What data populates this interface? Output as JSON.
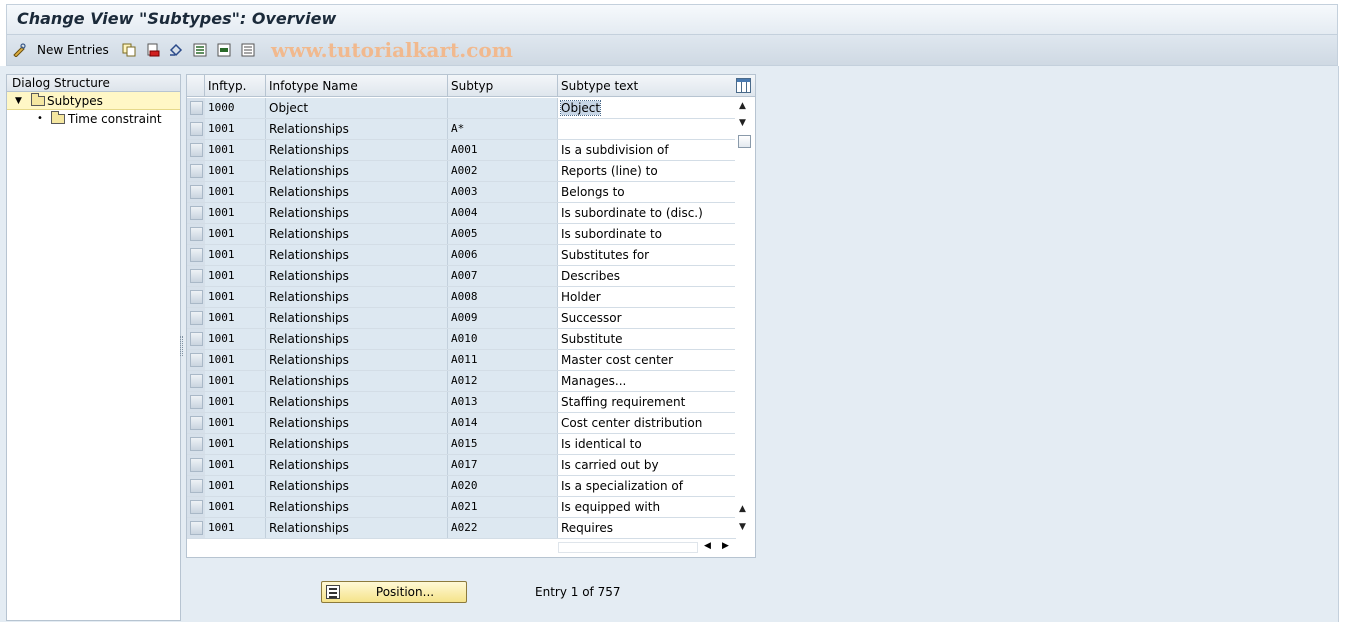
{
  "title": "Change View \"Subtypes\": Overview",
  "toolbar": {
    "new_entries_label": "New Entries"
  },
  "watermark": "www.tutorialkart.com",
  "dialog_structure": {
    "header": "Dialog Structure",
    "items": [
      {
        "label": "Subtypes"
      },
      {
        "label": "Time constraint"
      }
    ]
  },
  "table": {
    "columns": [
      "Inftyp.",
      "Infotype Name",
      "Subtyp",
      "Subtype text"
    ],
    "rows": [
      [
        "1000",
        "Object",
        "",
        "Object"
      ],
      [
        "1001",
        "Relationships",
        "A*",
        ""
      ],
      [
        "1001",
        "Relationships",
        "A001",
        "Is a subdivision of"
      ],
      [
        "1001",
        "Relationships",
        "A002",
        "Reports (line) to"
      ],
      [
        "1001",
        "Relationships",
        "A003",
        "Belongs to"
      ],
      [
        "1001",
        "Relationships",
        "A004",
        "Is subordinate to (disc.)"
      ],
      [
        "1001",
        "Relationships",
        "A005",
        "Is subordinate to"
      ],
      [
        "1001",
        "Relationships",
        "A006",
        "Substitutes for"
      ],
      [
        "1001",
        "Relationships",
        "A007",
        "Describes"
      ],
      [
        "1001",
        "Relationships",
        "A008",
        "Holder"
      ],
      [
        "1001",
        "Relationships",
        "A009",
        "Successor"
      ],
      [
        "1001",
        "Relationships",
        "A010",
        "Substitute"
      ],
      [
        "1001",
        "Relationships",
        "A011",
        "Master cost center"
      ],
      [
        "1001",
        "Relationships",
        "A012",
        "Manages..."
      ],
      [
        "1001",
        "Relationships",
        "A013",
        "Staffing requirement"
      ],
      [
        "1001",
        "Relationships",
        "A014",
        "Cost center distribution"
      ],
      [
        "1001",
        "Relationships",
        "A015",
        "Is identical to"
      ],
      [
        "1001",
        "Relationships",
        "A017",
        "Is carried out by"
      ],
      [
        "1001",
        "Relationships",
        "A020",
        "Is a specialization of"
      ],
      [
        "1001",
        "Relationships",
        "A021",
        "Is equipped with"
      ],
      [
        "1001",
        "Relationships",
        "A022",
        "Requires"
      ]
    ]
  },
  "footer": {
    "position_button_label": "Position...",
    "entry_info": "Entry 1 of 757"
  }
}
